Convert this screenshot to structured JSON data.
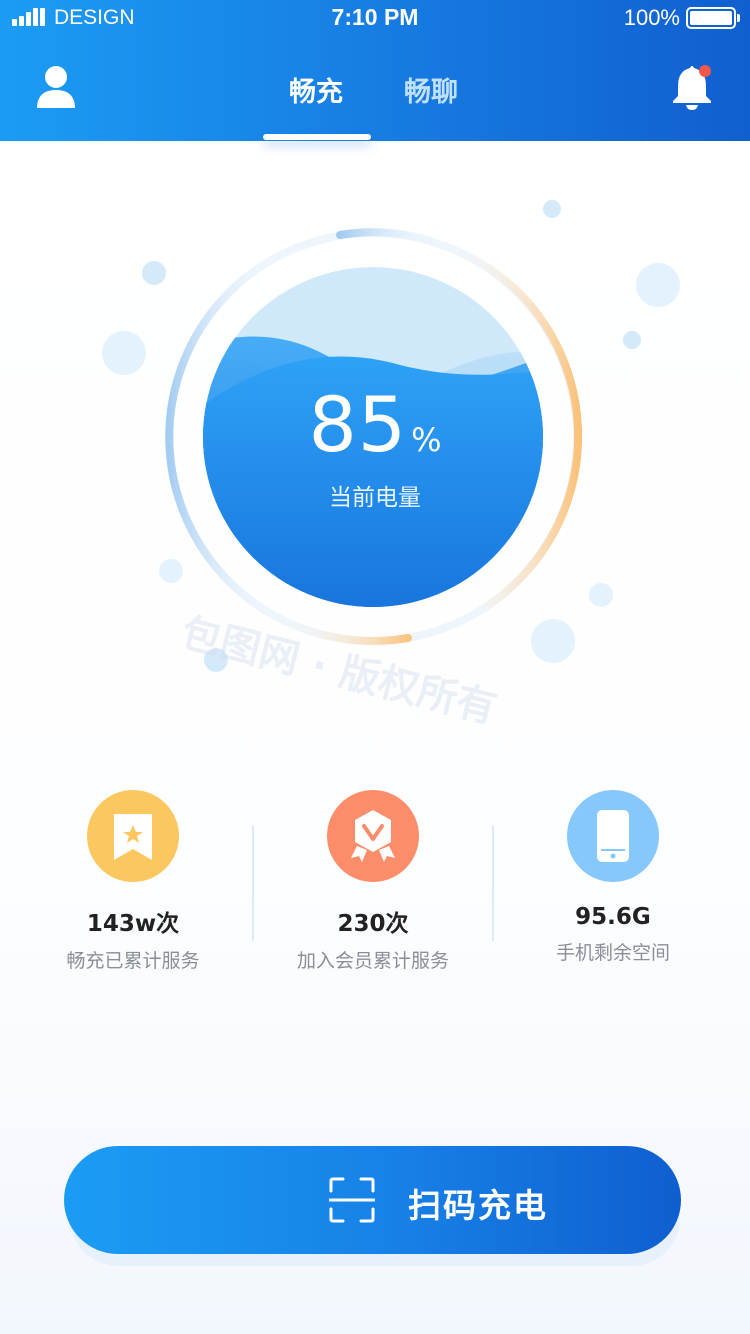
{
  "status_bar": {
    "carrier": "DESIGN",
    "time": "7:10 PM",
    "battery": "100%"
  },
  "header": {
    "tabs": [
      {
        "label": "畅充",
        "active": true
      },
      {
        "label": "畅聊",
        "active": false
      }
    ],
    "icons": {
      "left": "user-icon",
      "right": "bell-icon"
    },
    "notification_dot": true
  },
  "gauge": {
    "value": "85",
    "unit": "%",
    "label": "当前电量",
    "level": 0.85
  },
  "watermark": "包图网 · 版权所有",
  "stats": [
    {
      "value": "143w次",
      "label": "畅充已累计服务",
      "icon": "bookmark-star-icon",
      "color": "#fbc75e"
    },
    {
      "value": "230次",
      "label": "加入会员累计服务",
      "icon": "vip-badge-icon",
      "color": "#fb8d6b"
    },
    {
      "value": "95.6G",
      "label": "手机剩余空间",
      "icon": "phone-icon",
      "color": "#86c8fb"
    }
  ],
  "scan_button": {
    "label": "扫码充电",
    "icon": "scan-icon"
  },
  "colors": {
    "primary": "#1b9cf4",
    "primary_dark": "#0f5ecf",
    "ring_orange": "#fbbf73",
    "notification": "#f2584a"
  }
}
